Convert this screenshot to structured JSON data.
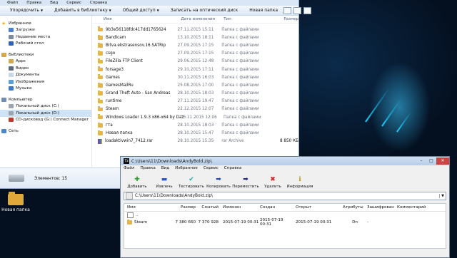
{
  "desktop": {
    "icon_label": "Новая папка"
  },
  "explorer": {
    "menu": [
      "Файл",
      "Правка",
      "Вид",
      "Сервис",
      "Справка"
    ],
    "commands": [
      "Упорядочить",
      "Добавить в библиотеку",
      "Общий доступ",
      "Записать на оптический диск",
      "Новая папка"
    ],
    "nav": {
      "favorites": {
        "label": "Избранное",
        "items": [
          "Загрузки",
          "Недавние места",
          "Рабочий стол"
        ]
      },
      "libraries": {
        "label": "Библиотеки",
        "items": [
          "Apps",
          "Видео",
          "Документы",
          "Изображения",
          "Музыка"
        ]
      },
      "computer": {
        "label": "Компьютер",
        "items": [
          "Локальный диск (C:)",
          "Локальный диск (D:)",
          "CD-дисковод (G:) Connect Manager"
        ]
      },
      "network": {
        "label": "Сеть"
      }
    },
    "columns": {
      "name": "Имя",
      "date": "Дата изменения",
      "type": "Тип",
      "size": "Размер"
    },
    "files": [
      {
        "name": "9b3e56118fdc417dd1765624",
        "date": "27.11.2015 15:11",
        "type": "Папка с файлами",
        "size": "",
        "icon": "folder"
      },
      {
        "name": "Bandicam",
        "date": "13.10.2015 18:11",
        "type": "Папка с файлами",
        "size": "",
        "icon": "folder"
      },
      {
        "name": "Bitva.ekstrasensov.16.SATRip",
        "date": "27.09.2015 17:15",
        "type": "Папка с файлами",
        "size": "",
        "icon": "folder"
      },
      {
        "name": "csgo",
        "date": "27.09.2015 17:15",
        "type": "Папка с файлами",
        "size": "",
        "icon": "folder"
      },
      {
        "name": "FileZilla FTP Client",
        "date": "29.06.2015 12:48",
        "type": "Папка с файлами",
        "size": "",
        "icon": "folder"
      },
      {
        "name": "forsage3",
        "date": "29.10.2015 17:11",
        "type": "Папка с файлами",
        "size": "",
        "icon": "folder"
      },
      {
        "name": "Games",
        "date": "30.11.2015 16:03",
        "type": "Папка с файлами",
        "size": "",
        "icon": "folder"
      },
      {
        "name": "GamesMailRu",
        "date": "25.08.2015 17:00",
        "type": "Папка с файлами",
        "size": "",
        "icon": "folder"
      },
      {
        "name": "Grand Theft Auto - San Andreas",
        "date": "28.10.2015 18:03",
        "type": "Папка с файлами",
        "size": "",
        "icon": "folder"
      },
      {
        "name": "runtime",
        "date": "27.11.2015 19:47",
        "type": "Папка с файлами",
        "size": "",
        "icon": "folder"
      },
      {
        "name": "Steam",
        "date": "22.12.2015 12:07",
        "type": "Папка с файлами",
        "size": "",
        "icon": "folder"
      },
      {
        "name": "Windows Loader 1.9.3 x86-x64 by Daz",
        "date": "05.11.2015 12:06",
        "type": "Папка с файлами",
        "size": "",
        "icon": "folder"
      },
      {
        "name": "гта",
        "date": "28.10.2015 18:03",
        "type": "Папка с файлами",
        "size": "",
        "icon": "folder"
      },
      {
        "name": "Новая папка",
        "date": "28.10.2015 15:47",
        "type": "Папка с файлами",
        "size": "",
        "icon": "folder"
      },
      {
        "name": "loadaktivwin7_7412.rar",
        "date": "28.10.2015 15:35",
        "type": "rar Archive",
        "size": "8 850 КБ",
        "icon": "rar"
      }
    ],
    "status": "Элементов: 15"
  },
  "zip": {
    "title": "C:\\Users\\11\\Downloads\\AndyBold.zip\\",
    "menu": [
      "Файл",
      "Правка",
      "Вид",
      "Избранное",
      "Сервис",
      "Справка"
    ],
    "tools": [
      {
        "label": "Добавить",
        "icon": "add-icon",
        "glyph": "✚",
        "color": "#2aa52a"
      },
      {
        "label": "Извлечь",
        "icon": "extract-icon",
        "glyph": "▬",
        "color": "#2855c8"
      },
      {
        "label": "Тестировать",
        "icon": "test-icon",
        "glyph": "✔",
        "color": "#2aa5a5"
      },
      {
        "label": "Копировать",
        "icon": "copy-icon",
        "glyph": "➡",
        "color": "#1f46b0"
      },
      {
        "label": "Переместить",
        "icon": "move-icon",
        "glyph": "➡",
        "color": "#1e2a7a"
      },
      {
        "label": "Удалить",
        "icon": "delete-icon",
        "glyph": "✖",
        "color": "#d42222"
      },
      {
        "label": "Информация",
        "icon": "info-icon",
        "glyph": "ℹ",
        "color": "#b8960a"
      }
    ],
    "path": "C:\\Users\\11\\Downloads\\AndyBold.zip\\",
    "columns": [
      "Имя",
      "Размер",
      "Сжатый",
      "Изменен",
      "Создан",
      "Открыт",
      "Атрибуты",
      "Зашифрован",
      "Комментарий"
    ],
    "rows": [
      {
        "name": "..",
        "size": "",
        "packed": "",
        "modified": "",
        "created": "",
        "accessed": "",
        "attr": "",
        "enc": "",
        "comment": "",
        "icon": "up"
      },
      {
        "name": "Steam",
        "size": "7 380 660",
        "packed": "7 370 928",
        "modified": "2015-07-19 00:31",
        "created": "2015-07-19 00:31",
        "accessed": "2015-07-19 00:31",
        "attr": "Dn",
        "enc": "-",
        "comment": "",
        "icon": "folder"
      }
    ]
  }
}
